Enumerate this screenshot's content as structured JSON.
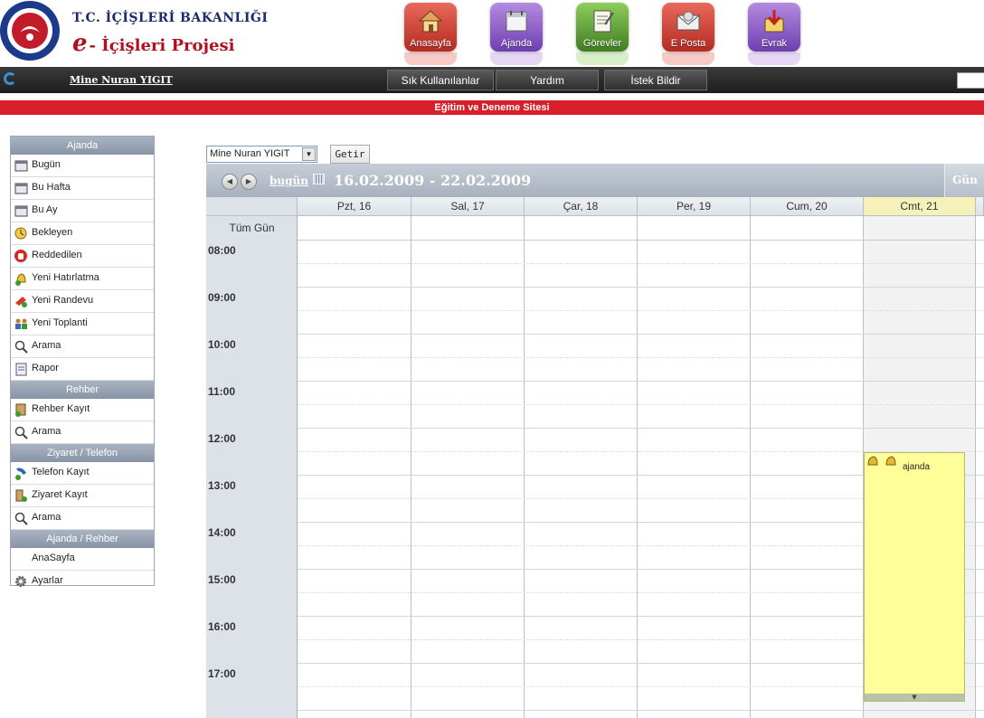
{
  "header": {
    "ministry": "T.C. İÇİŞLERİ BAKANLIĞI",
    "project_e": "e",
    "project": "- İçişleri Projesi",
    "icons": [
      {
        "label": "Anasayfa",
        "icon": "home-icon",
        "color": "#c9352c"
      },
      {
        "label": "Ajanda",
        "icon": "calendar-icon",
        "color": "#7a4bb5"
      },
      {
        "label": "Görevler",
        "icon": "tasks-icon",
        "color": "#4d8a2a"
      },
      {
        "label": "E Posta",
        "icon": "mail-icon",
        "color": "#c9352c"
      },
      {
        "label": "Evrak",
        "icon": "document-icon",
        "color": "#7a4bb5"
      }
    ]
  },
  "nav": {
    "user": "Mine Nuran YIGIT",
    "buttons": [
      "Sık Kullanılanlar",
      "Yardım",
      "İstek Bildir"
    ]
  },
  "site_banner": "Eğitim ve Deneme Sitesi",
  "sidebar": {
    "sections": [
      {
        "title": "Ajanda",
        "items": [
          {
            "label": "Bugün",
            "icon": "day-calendar-icon"
          },
          {
            "label": "Bu Hafta",
            "icon": "week-calendar-icon"
          },
          {
            "label": "Bu Ay",
            "icon": "month-calendar-icon"
          },
          {
            "label": "Bekleyen",
            "icon": "clock-icon"
          },
          {
            "label": "Reddedilen",
            "icon": "stop-hand-icon"
          },
          {
            "label": "Yeni Hatırlatma",
            "icon": "reminder-bell-icon"
          },
          {
            "label": "Yeni Randevu",
            "icon": "appointment-icon"
          },
          {
            "label": "Yeni Toplanti",
            "icon": "meeting-icon"
          },
          {
            "label": "Arama",
            "icon": "magnifier-icon"
          },
          {
            "label": "Rapor",
            "icon": "report-icon"
          }
        ]
      },
      {
        "title": "Rehber",
        "items": [
          {
            "label": "Rehber Kayıt",
            "icon": "contact-add-icon"
          },
          {
            "label": "Arama",
            "icon": "magnifier-icon"
          }
        ]
      },
      {
        "title": "Ziyaret / Telefon",
        "items": [
          {
            "label": "Telefon Kayıt",
            "icon": "phone-icon"
          },
          {
            "label": "Ziyaret Kayıt",
            "icon": "visitor-icon"
          },
          {
            "label": "Arama",
            "icon": "magnifier-icon"
          }
        ]
      },
      {
        "title": "Ajanda / Rehber",
        "items": [
          {
            "label": "AnaSayfa",
            "icon": ""
          },
          {
            "label": "Ayarlar",
            "icon": "gear-icon"
          }
        ]
      }
    ]
  },
  "calendar": {
    "user_select": "Mine Nuran YIGIT",
    "fetch_button": "Getir",
    "today_link": "bugün",
    "date_range": "16.02.2009 - 22.02.2009",
    "view_button": "Gün",
    "all_day_label": "Tüm Gün",
    "days": [
      "Pzt, 16",
      "Sal, 17",
      "Çar, 18",
      "Per, 19",
      "Cum, 20",
      "Cmt, 21"
    ],
    "selected_day": "Cmt, 21",
    "hours": [
      "08:00",
      "09:00",
      "10:00",
      "11:00",
      "12:00",
      "13:00",
      "14:00",
      "15:00",
      "16:00",
      "17:00"
    ],
    "event": {
      "label": "ajanda",
      "day": "Cmt, 21",
      "start": "12:30"
    }
  },
  "colors": {
    "banner_red": "#d81e2a",
    "event_yellow": "#ffff99",
    "header_bar": "#1e1e1e"
  }
}
